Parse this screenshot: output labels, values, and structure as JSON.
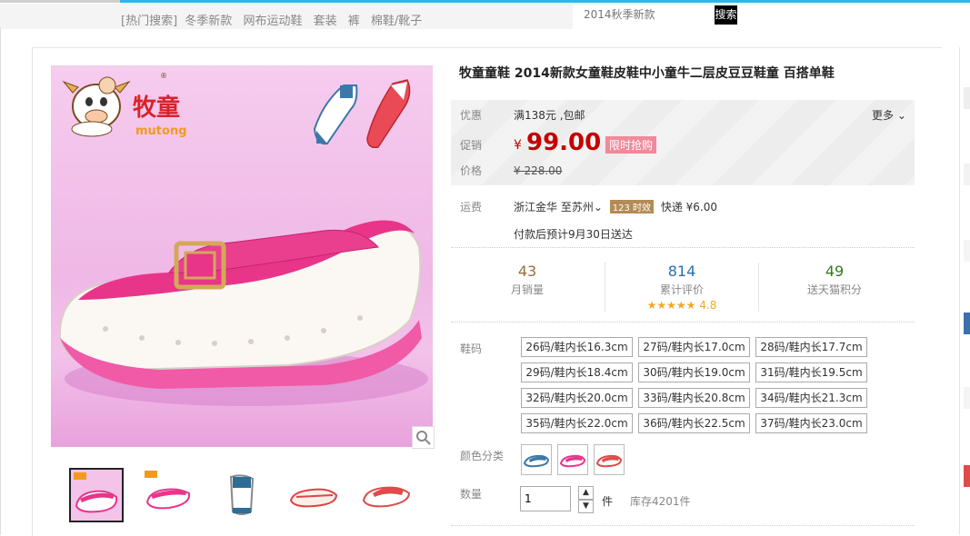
{
  "header": {
    "hot_label": "[热门搜索]",
    "hot_items": [
      "冬季新款",
      "网布运动鞋",
      "套装",
      "裤",
      "棉鞋/靴子"
    ],
    "search_placeholder": "2014秋季新款",
    "search_button": "搜索"
  },
  "gallery": {
    "brand_cn": "牧童",
    "brand_en": "mutong",
    "zoom_icon": "magnifier-icon",
    "thumbs": [
      "thumb-1",
      "thumb-2",
      "thumb-3",
      "thumb-4",
      "thumb-5"
    ]
  },
  "product": {
    "title": "牧童童鞋 2014新款女童鞋皮鞋中小童牛二层皮豆豆鞋童 百搭单鞋",
    "promo_label": "优惠",
    "promo_text": "满138元 ,包邮",
    "more_label": "更多",
    "sale_label": "促销",
    "currency": "¥",
    "sale_price": "99.00",
    "sale_badge": "限时抢购",
    "price_label": "价格",
    "original_price": "¥ 228.00",
    "shipping_label": "运费",
    "ship_from": "浙江金华",
    "ship_to": "至苏州",
    "timely_badge": "123 时效",
    "express": "快递 ¥6.00",
    "delivery": "付款后预计9月30日送达",
    "accent_color": "#c40000"
  },
  "stats": [
    {
      "value": "43",
      "label": "月销量",
      "color": "#9b6b3a"
    },
    {
      "value": "814",
      "label": "累计评价",
      "color": "#2a6fb0"
    },
    {
      "value": "49",
      "label": "送天猫积分",
      "color": "#2e7d1f"
    }
  ],
  "rating": {
    "stars": "★★★★★",
    "score": "4.8"
  },
  "sizes": {
    "label": "鞋码",
    "options": [
      "26码/鞋内长16.3cm",
      "27码/鞋内长17.0cm",
      "28码/鞋内长17.7cm",
      "29码/鞋内长18.4cm",
      "30码/鞋内长19.0cm",
      "31码/鞋内长19.5cm",
      "32码/鞋内长20.0cm",
      "33码/鞋内长20.8cm",
      "34码/鞋内长21.3cm",
      "35码/鞋内长22.0cm",
      "36码/鞋内长22.5cm",
      "37码/鞋内长23.0cm"
    ]
  },
  "colors": {
    "label": "颜色分类",
    "options": [
      "blue-shoe",
      "pink-shoe",
      "red-shoe"
    ]
  },
  "quantity": {
    "label": "数量",
    "value": "1",
    "unit": "件",
    "stock": "库存4201件"
  }
}
